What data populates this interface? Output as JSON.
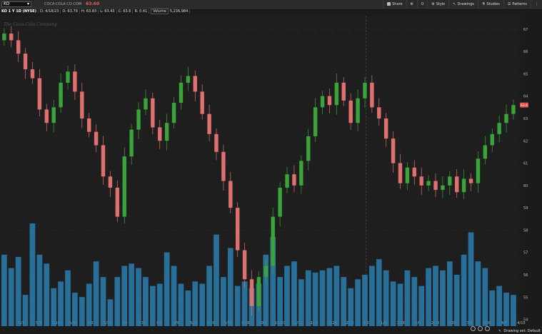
{
  "symbol_input": {
    "value": "KO"
  },
  "header": {
    "company": "COCA-COLA CO COM",
    "last_price": "63.60",
    "chart_label": "KO 1 Y 1D (NYSE)",
    "date": "D: 4/18/23",
    "open": "O: 63.79",
    "high": "H: 63.83",
    "low": "L: 63.43",
    "close": "C: 63.6",
    "range": "R: 0.41",
    "volume_label": "Volume",
    "volume_value": "5,236,984"
  },
  "toolbar": {
    "share": "Share",
    "settings_value": "0",
    "style": "Style",
    "drawings": "Drawings",
    "studies": "Studies",
    "patterns": "Patterns"
  },
  "watermark": "The Coca-Cola Company",
  "status": {
    "drawing_set": "Drawing set: Default"
  },
  "colors": {
    "up": "#3aa33a",
    "down": "#e07070",
    "volume": "#2a7fb0",
    "price_tag": "#e04848"
  },
  "chart_data": {
    "type": "candlestick",
    "title": "KO 1 Y 1D (NYSE)",
    "y_ticks": [
      54,
      55,
      56,
      57,
      58,
      59,
      60,
      61,
      62,
      63,
      64,
      65,
      66,
      67
    ],
    "y_range": [
      53.7,
      67.6
    ],
    "last_price": 63.6,
    "x_tick_labels": [
      "5/3",
      "5/9",
      "5/16",
      "5/30",
      "6/6",
      "6/30",
      "7/4",
      "7/11",
      "8/1",
      "8/8",
      "8/15",
      "8/28",
      "9/12",
      "9/19",
      "10/3",
      "10/10",
      "10/31",
      "11/7",
      "11/28",
      "12/12",
      "1/2",
      "1/9",
      "1/16",
      "2/6",
      "2/13",
      "2/27",
      "3/6",
      "3/20",
      "4/5",
      "4/10"
    ],
    "close_series": [
      66.8,
      66.5,
      65.9,
      65.2,
      64.8,
      63.4,
      62.8,
      63.5,
      64.6,
      65.1,
      64.2,
      63.0,
      62.4,
      61.8,
      60.4,
      59.9,
      58.6,
      61.3,
      62.5,
      63.4,
      63.9,
      62.6,
      62.0,
      62.8,
      63.7,
      64.6,
      64.9,
      64.2,
      63.2,
      62.3,
      61.5,
      60.2,
      59.0,
      57.1,
      55.8,
      54.6,
      55.9,
      56.4,
      58.6,
      59.9,
      60.5,
      60.0,
      61.1,
      62.2,
      63.5,
      64.0,
      63.6,
      64.6,
      63.8,
      62.8,
      63.9,
      64.6,
      63.5,
      63.0,
      62.1,
      61.0,
      60.1,
      60.8,
      60.4,
      60.0,
      60.2,
      59.8,
      60.0,
      60.4,
      59.7,
      60.3,
      60.1,
      61.2,
      61.8,
      62.3,
      62.8,
      63.2,
      63.6
    ],
    "volume_series": [
      56.9,
      56.3,
      56.8,
      55.1,
      58.3,
      56.9,
      56.5,
      55.4,
      55.7,
      56.2,
      55.2,
      55.0,
      55.6,
      56.6,
      55.9,
      54.9,
      55.9,
      56.4,
      56.5,
      56.3,
      55.9,
      55.5,
      55.6,
      57.0,
      56.4,
      55.6,
      55.3,
      55.7,
      55.6,
      56.4,
      57.8,
      55.9,
      57.2,
      55.5,
      55.7,
      55.4,
      55.6,
      56.9,
      57.7,
      55.9,
      56.4,
      56.6,
      55.8,
      56.2,
      56.1,
      56.2,
      56.3,
      56.4,
      55.9,
      55.4,
      55.8,
      56.0,
      56.4,
      56.7,
      56.2,
      55.7,
      55.6,
      56.2,
      55.9,
      55.5,
      56.3,
      56.4,
      56.2,
      56.6,
      56.0,
      56.9,
      57.9,
      56.6,
      56.3,
      55.3,
      55.5,
      55.2,
      55.1
    ]
  }
}
